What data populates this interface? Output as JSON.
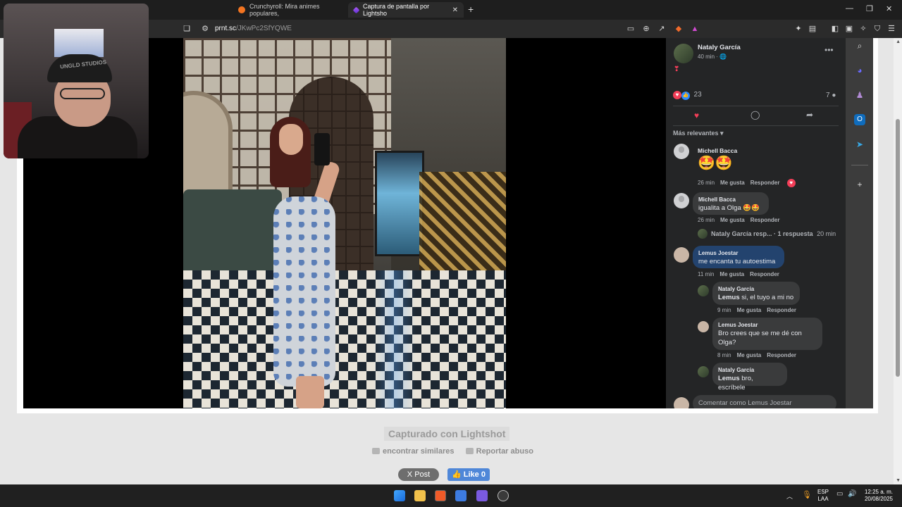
{
  "browser": {
    "tabs": [
      {
        "title": "Crunchyroll: Mira animes populares,"
      },
      {
        "title": "Captura de pantalla por Lightsho",
        "active": true
      }
    ],
    "url_domain": "prnt.sc",
    "url_path": "/JKwPc2SfYQWE"
  },
  "facebook_post": {
    "author": "Nataly García",
    "time": "40 min ·",
    "reaction_count": "23",
    "comment_count": "7",
    "sort_label": "Más relevantes",
    "comments": [
      {
        "author": "Michell Bacca",
        "text": "🤩🤩",
        "time": "26 min",
        "like": "Me gusta",
        "reply": "Responder"
      },
      {
        "author": "Michell Bacca",
        "text": "igualita a Olga 🤩🤩",
        "time": "26 min",
        "like": "Me gusta",
        "reply": "Responder",
        "replies_summary": "Nataly García resp... · 1 respuesta",
        "replies_time": "20 min"
      },
      {
        "author": "Lemus Joestar",
        "text": "me encanta tu autoestima",
        "time": "11 min",
        "like": "Me gusta",
        "reply": "Responder"
      }
    ],
    "replies": [
      {
        "author": "Nataly García",
        "mention": "Lemus",
        "text": " si, el tuyo a mi no",
        "time": "9 min",
        "like": "Me gusta",
        "reply": "Responder"
      },
      {
        "author": "Lemus Joestar",
        "text": "Bro crees que se me dé con Olga?",
        "time": "8 min",
        "like": "Me gusta",
        "reply": "Responder"
      },
      {
        "author": "Nataly García",
        "mention": "Lemus",
        "text": " bro, escríbele"
      }
    ],
    "comment_placeholder": "Comentar como Lemus Joestar"
  },
  "lightshot": {
    "caption": "Capturado con Lightshot",
    "find_similar": "encontrar similares",
    "report_abuse": "Reportar abuso",
    "post_button": "X Post",
    "like_button": "👍 Like 0"
  },
  "webcam": {
    "cap_text": "UNGLD STUDIOS"
  },
  "taskbar": {
    "language": "ESP",
    "layout": "LAA",
    "time": "12:25 a. m.",
    "date": "20/08/2025"
  },
  "colors": {
    "fb_bg": "#242526",
    "fb_blue_bubble": "#23436e",
    "heart": "#f33e58",
    "like_blue": "#4f87d8"
  }
}
